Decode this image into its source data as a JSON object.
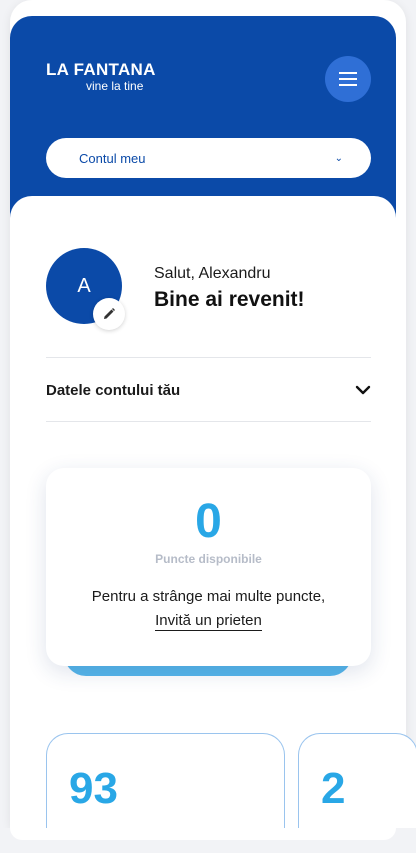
{
  "header": {
    "logo_main": "LA FANTANA",
    "logo_sub": "vine la tine",
    "menu_icon": "hamburger-menu-icon"
  },
  "account_select": {
    "label": "Contul meu",
    "icon": "chevron-down-icon"
  },
  "profile": {
    "avatar_initial": "A",
    "greeting": "Salut, Alexandru",
    "welcome": "Bine ai revenit!",
    "edit_icon": "pencil-icon"
  },
  "account_data": {
    "label": "Datele contului tău",
    "icon": "chevron-down-icon"
  },
  "points": {
    "value": "0",
    "label": "Puncte disponibile",
    "text": "Pentru a strânge mai multe puncte,",
    "invite": "Invită un prieten"
  },
  "stats": [
    {
      "value": "93"
    },
    {
      "value": "2"
    }
  ],
  "colors": {
    "brand_blue": "#0b4aa8",
    "accent_blue": "#29a7e6",
    "menu_button": "#2f6fd6"
  }
}
